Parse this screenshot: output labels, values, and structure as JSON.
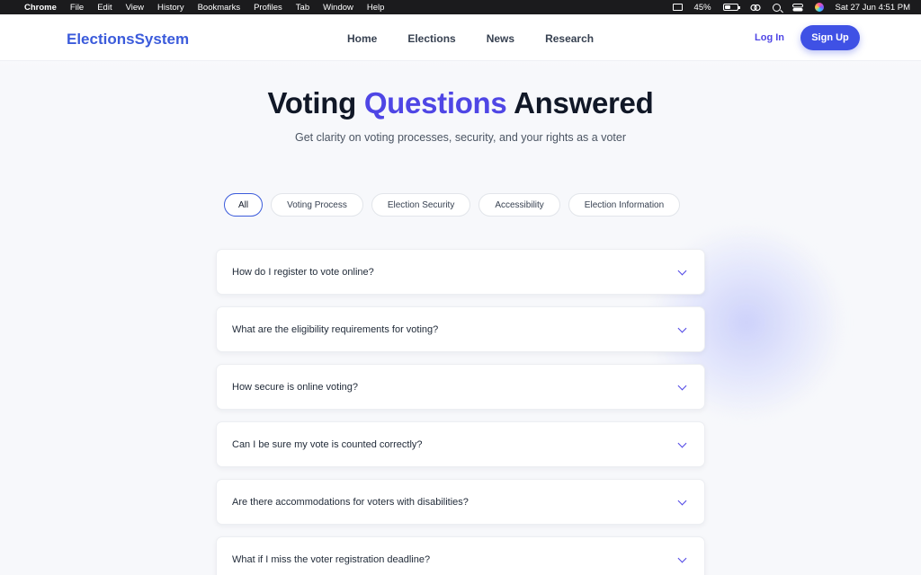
{
  "menubar": {
    "app": "Chrome",
    "menus": [
      "File",
      "Edit",
      "View",
      "History",
      "Bookmarks",
      "Profiles",
      "Tab",
      "Window",
      "Help"
    ],
    "battery": "45%",
    "datetime": "Sat 27 Jun  4:51 PM"
  },
  "header": {
    "logo": "ElectionsSystem",
    "nav": [
      "Home",
      "Elections",
      "News",
      "Research"
    ],
    "login": "Log In",
    "signup": "Sign Up"
  },
  "hero": {
    "title_pre": "Voting ",
    "title_accent": "Questions",
    "title_post": " Answered",
    "subtitle": "Get clarity on voting processes, security, and your rights as a voter"
  },
  "filters": [
    "All",
    "Voting Process",
    "Election Security",
    "Accessibility",
    "Election Information"
  ],
  "active_filter": "All",
  "faqs": [
    "How do I register to vote online?",
    "What are the eligibility requirements for voting?",
    "How secure is online voting?",
    "Can I be sure my vote is counted correctly?",
    "Are there accommodations for voters with disabilities?",
    "What if I miss the voter registration deadline?"
  ],
  "colors": {
    "brand": "#3b5bdb",
    "accent": "#4f46e5",
    "button": "#3f51e5"
  }
}
